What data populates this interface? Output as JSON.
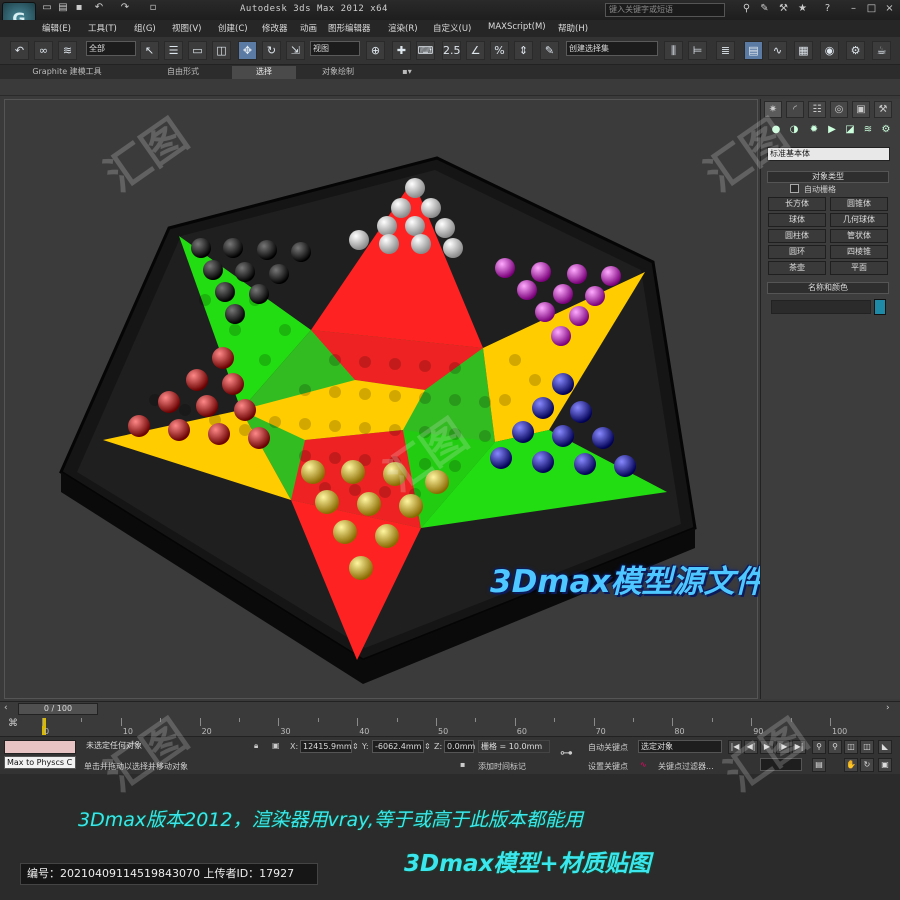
{
  "app": {
    "title": "Autodesk 3ds Max  2012 x64",
    "logo_glyph": "G",
    "search_placeholder": "键入关键字或短语",
    "menu": [
      "编辑(E)",
      "工具(T)",
      "组(G)",
      "视图(V)",
      "创建(C)",
      "修改器",
      "动画",
      "图形编辑器",
      "渲染(R)",
      "自定义(U)",
      "MAXScript(M)",
      "帮助(H)"
    ]
  },
  "toolbar": {
    "selection_filter": "全部",
    "ref_coord": "视图",
    "snap_label": "2.5",
    "named_selection": "创建选择集"
  },
  "ribbon": {
    "tabs": [
      "Graphite 建模工具",
      "自由形式",
      "选择",
      "对象绘制"
    ],
    "active_tab": "选择"
  },
  "command_panel": {
    "category": "标准基本体",
    "rollout_object_type": "对象类型",
    "autogrid_label": "自动栅格",
    "object_buttons": [
      "长方体",
      "圆锥体",
      "球体",
      "几何球体",
      "圆柱体",
      "管状体",
      "圆环",
      "四棱锥",
      "茶壶",
      "平面"
    ],
    "rollout_name_color": "名称和颜色",
    "object_color": "#1f8aa8"
  },
  "timeline": {
    "frame_label": "0 / 100",
    "ticks": [
      "0",
      "10",
      "20",
      "30",
      "40",
      "50",
      "60",
      "70",
      "80",
      "90",
      "100"
    ]
  },
  "status": {
    "listener_text": "Max to Physcs C",
    "selection_status": "未选定任何对象",
    "prompt": "单击并拖动以选择并移动对象",
    "x_label": "X:",
    "x_value": "12415.9mm",
    "y_label": "Y:",
    "y_value": "-6062.4mm",
    "z_label": "Z:",
    "z_value": "0.0mm",
    "grid": "栅格 = 10.0mm",
    "add_time_tag": "添加时间标记",
    "auto_key": "自动关键点",
    "set_key": "设置关键点",
    "key_mode": "选定对象",
    "key_filters": "关键点过滤器..."
  },
  "scene": {
    "overlay_text": "3Dmax模型源文件",
    "board_base_color": "#141414",
    "arm_colors": [
      "#ff2a2a",
      "#ffcc00",
      "#22dd11"
    ],
    "marble_colors": {
      "white": "#f4f4f4",
      "black": "#111111",
      "magenta": "#dd22dd",
      "red": "#dd1111",
      "blue": "#2222cc",
      "yellow": "#f2cc00"
    }
  },
  "footer": {
    "version_line": "3Dmax版本2012，渲染器用vray,等于或高于此版本都能用",
    "model_tag": "3Dmax模型+材质贴图",
    "id_line": "编号：20210409114519843070 上传者ID：17927"
  },
  "watermark": "汇图网"
}
